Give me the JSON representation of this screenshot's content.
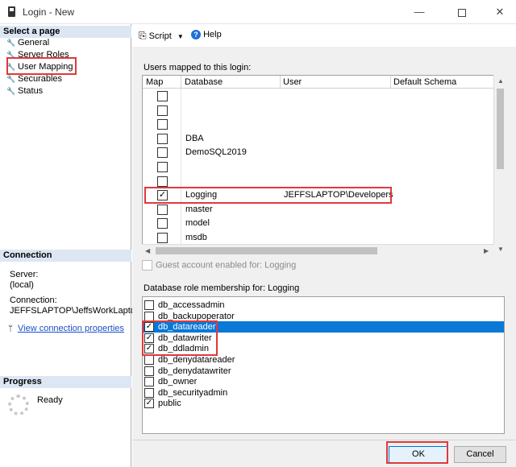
{
  "window": {
    "title": "Login - New",
    "controls": {
      "minimize": "—",
      "close": "✕"
    }
  },
  "sidebar": {
    "select_page_header": "Select a page",
    "items": [
      {
        "label": "General"
      },
      {
        "label": "Server Roles"
      },
      {
        "label": "User Mapping"
      },
      {
        "label": "Securables"
      },
      {
        "label": "Status"
      }
    ],
    "connection": {
      "header": "Connection",
      "server_label": "Server:",
      "server_value": "(local)",
      "connection_label": "Connection:",
      "connection_value": "JEFFSLAPTOP\\JeffsWorkLaptop",
      "view_link": "View connection properties"
    },
    "progress": {
      "header": "Progress",
      "status": "Ready"
    }
  },
  "toolbar": {
    "script_label": "Script",
    "help_label": "Help"
  },
  "users_mapped": {
    "label": "Users mapped to this login:",
    "columns": [
      "Map",
      "Database",
      "User",
      "Default Schema"
    ],
    "rows": [
      {
        "checked": false,
        "database": "",
        "user": "",
        "schema": ""
      },
      {
        "checked": false,
        "database": "",
        "user": "",
        "schema": ""
      },
      {
        "checked": false,
        "database": "",
        "user": "",
        "schema": ""
      },
      {
        "checked": false,
        "database": "DBA",
        "user": "",
        "schema": ""
      },
      {
        "checked": false,
        "database": "DemoSQL2019",
        "user": "",
        "schema": ""
      },
      {
        "checked": false,
        "database": "",
        "user": "",
        "schema": ""
      },
      {
        "checked": false,
        "database": "",
        "user": "",
        "schema": ""
      },
      {
        "checked": true,
        "database": "Logging",
        "user": "JEFFSLAPTOP\\Developers",
        "schema": ""
      },
      {
        "checked": false,
        "database": "master",
        "user": "",
        "schema": ""
      },
      {
        "checked": false,
        "database": "model",
        "user": "",
        "schema": ""
      },
      {
        "checked": false,
        "database": "msdb",
        "user": "",
        "schema": ""
      }
    ]
  },
  "guest": {
    "label": "Guest account enabled for: Logging",
    "checked": false
  },
  "role_membership": {
    "label": "Database role membership for: Logging",
    "roles": [
      {
        "name": "db_accessadmin",
        "checked": false,
        "selected": false
      },
      {
        "name": "db_backupoperator",
        "checked": false,
        "selected": false
      },
      {
        "name": "db_datareader",
        "checked": true,
        "selected": true
      },
      {
        "name": "db_datawriter",
        "checked": true,
        "selected": false
      },
      {
        "name": "db_ddladmin",
        "checked": true,
        "selected": false
      },
      {
        "name": "db_denydatareader",
        "checked": false,
        "selected": false
      },
      {
        "name": "db_denydatawriter",
        "checked": false,
        "selected": false
      },
      {
        "name": "db_owner",
        "checked": false,
        "selected": false
      },
      {
        "name": "db_securityadmin",
        "checked": false,
        "selected": false
      },
      {
        "name": "public",
        "checked": true,
        "selected": false
      }
    ]
  },
  "buttons": {
    "ok": "OK",
    "cancel": "Cancel"
  },
  "colors": {
    "highlight_box": "#e0393c",
    "selection": "#0a78d7",
    "link": "#1a4fc7"
  }
}
